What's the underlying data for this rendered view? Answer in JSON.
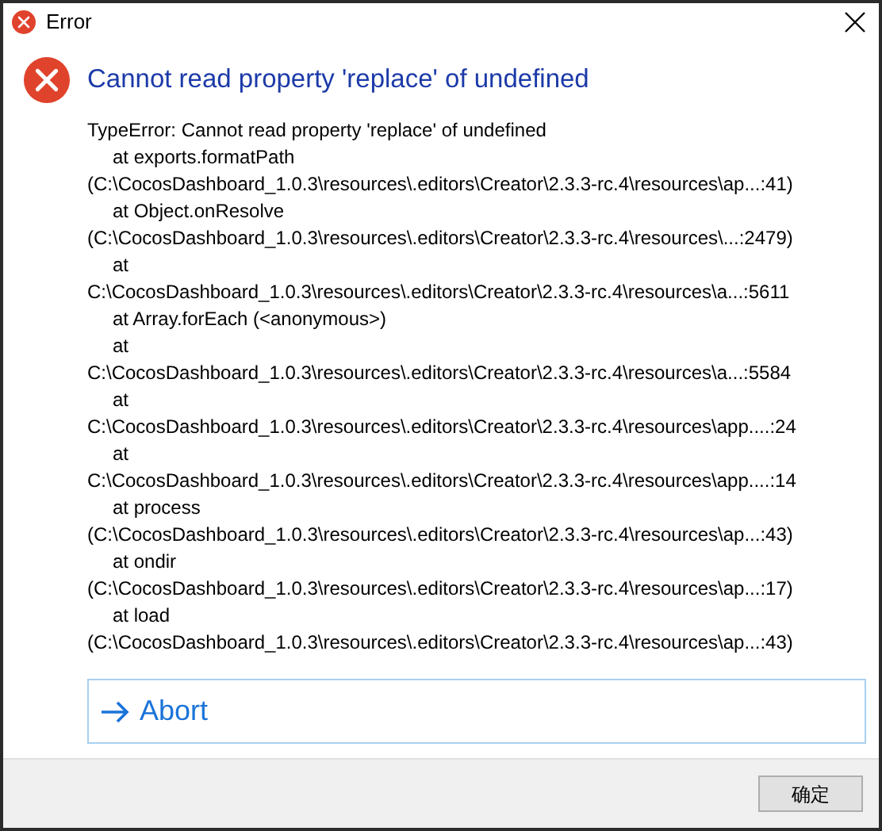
{
  "window": {
    "title": "Error"
  },
  "heading": "Cannot read property 'replace' of undefined",
  "details": [
    {
      "kind": "message",
      "text": "TypeError: Cannot read property 'replace' of undefined"
    },
    {
      "kind": "frame",
      "text": "at exports.formatPath"
    },
    {
      "kind": "location",
      "text": "(C:\\CocosDashboard_1.0.3\\resources\\.editors\\Creator\\2.3.3-rc.4\\resources\\ap...:41)"
    },
    {
      "kind": "frame",
      "text": "at Object.onResolve"
    },
    {
      "kind": "location",
      "text": "(C:\\CocosDashboard_1.0.3\\resources\\.editors\\Creator\\2.3.3-rc.4\\resources\\...:2479)"
    },
    {
      "kind": "frame",
      "text": "at"
    },
    {
      "kind": "location",
      "text": "C:\\CocosDashboard_1.0.3\\resources\\.editors\\Creator\\2.3.3-rc.4\\resources\\a...:5611"
    },
    {
      "kind": "frame",
      "text": "at Array.forEach (<anonymous>)"
    },
    {
      "kind": "frame",
      "text": "at"
    },
    {
      "kind": "location",
      "text": "C:\\CocosDashboard_1.0.3\\resources\\.editors\\Creator\\2.3.3-rc.4\\resources\\a...:5584"
    },
    {
      "kind": "frame",
      "text": "at"
    },
    {
      "kind": "location",
      "text": "C:\\CocosDashboard_1.0.3\\resources\\.editors\\Creator\\2.3.3-rc.4\\resources\\app....:24"
    },
    {
      "kind": "frame",
      "text": "at"
    },
    {
      "kind": "location",
      "text": "C:\\CocosDashboard_1.0.3\\resources\\.editors\\Creator\\2.3.3-rc.4\\resources\\app....:14"
    },
    {
      "kind": "frame",
      "text": "at process"
    },
    {
      "kind": "location",
      "text": "(C:\\CocosDashboard_1.0.3\\resources\\.editors\\Creator\\2.3.3-rc.4\\resources\\ap...:43)"
    },
    {
      "kind": "frame",
      "text": "at ondir"
    },
    {
      "kind": "location",
      "text": "(C:\\CocosDashboard_1.0.3\\resources\\.editors\\Creator\\2.3.3-rc.4\\resources\\ap...:17)"
    },
    {
      "kind": "frame",
      "text": "at load"
    },
    {
      "kind": "location",
      "text": "(C:\\CocosDashboard_1.0.3\\resources\\.editors\\Creator\\2.3.3-rc.4\\resources\\ap...:43)"
    }
  ],
  "command": {
    "label": "Abort"
  },
  "buttons": [
    {
      "label": "确定"
    }
  ]
}
